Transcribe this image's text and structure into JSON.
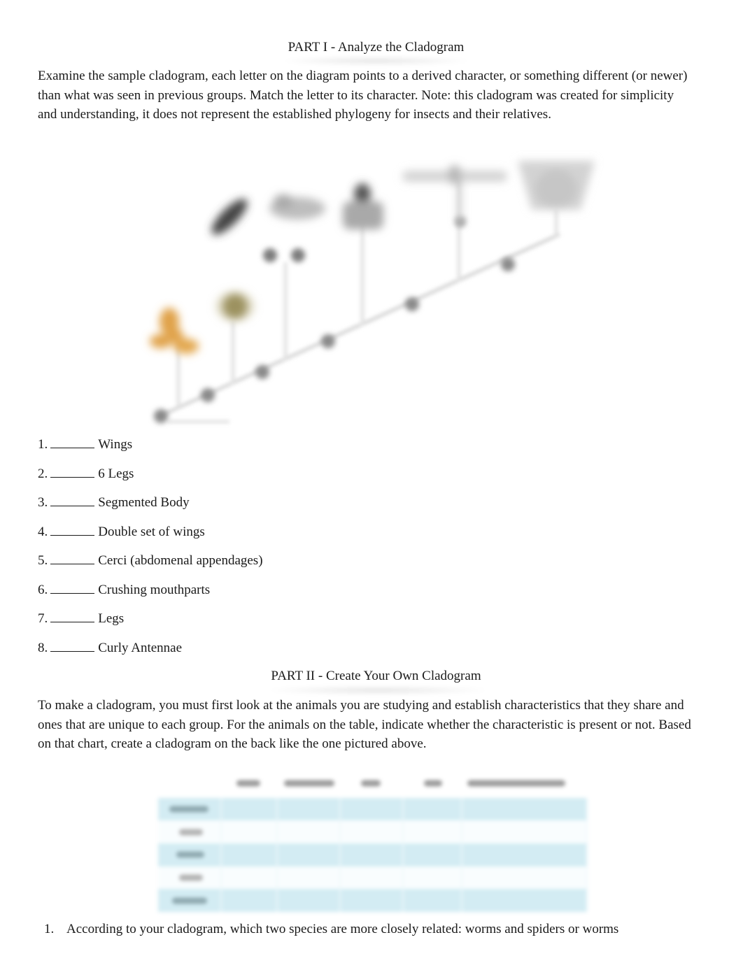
{
  "part1": {
    "heading": "PART I - Analyze the Cladogram",
    "intro": "Examine the sample cladogram, each letter on the diagram points to a derived character, or something different (or newer) than what was seen in previous groups. Match the letter to its character. Note: this cladogram was created for simplicity and understanding, it does not represent the established phylogeny for insects and their relatives.",
    "figure": {
      "description": "Blurred cladogram image with organism silhouettes and lettered nodes",
      "colors": {
        "line": "#d9d9d9",
        "node": "#7a7a7a",
        "organism_orange": "#e0a24a",
        "organism_olive": "#6f6328",
        "organism_dark": "#3c3c3c"
      }
    },
    "matching_items": [
      {
        "number": "1.",
        "blank": "______",
        "label": "Wings"
      },
      {
        "number": "2.",
        "blank": "______",
        "label": "6 Legs"
      },
      {
        "number": "3.",
        "blank": "______",
        "label": "Segmented Body"
      },
      {
        "number": "4.",
        "blank": "______",
        "label": "Double set of wings"
      },
      {
        "number": "5.",
        "blank": "______",
        "label": "Cerci (abdomenal appendages)"
      },
      {
        "number": "6.",
        "blank": "______",
        "label": "Crushing mouthparts"
      },
      {
        "number": "7.",
        "blank": "______",
        "label": "Legs"
      },
      {
        "number": "8.",
        "blank": "______",
        "label": "Curly Antennae"
      }
    ]
  },
  "part2": {
    "heading": "PART II - Create Your Own Cladogram",
    "intro": "To make a cladogram, you must first look at the animals you are studying and establish characteristics that they share and ones that are unique to each group. For the animals on the table, indicate whether the characteristic is present or not. Based on that chart, create a cladogram on the back like the one pictured above.",
    "table": {
      "note": "Table content is blurred and illegible",
      "colors": {
        "row_shade": "#d3ecf3",
        "row_plain": "#f9fdfe"
      },
      "column_count": 6,
      "row_count": 5
    },
    "questions": [
      {
        "number": "1.",
        "text": "According to your cladogram, which two species are more closely related: worms and spiders or worms"
      }
    ]
  }
}
